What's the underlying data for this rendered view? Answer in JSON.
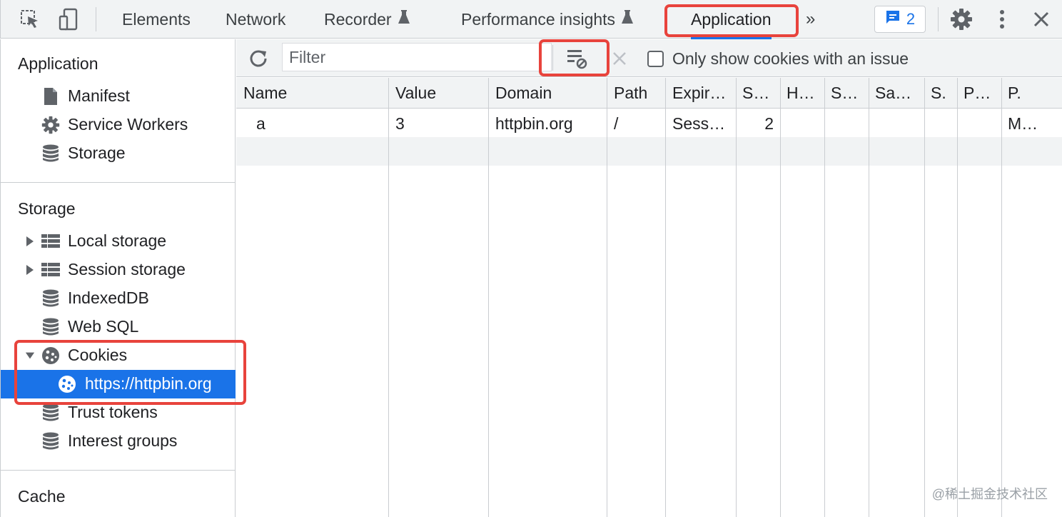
{
  "tabs": {
    "elements": "Elements",
    "network": "Network",
    "recorder": "Recorder",
    "performance_insights": "Performance insights",
    "application": "Application",
    "more": "»",
    "issues_count": "2"
  },
  "sidebar": {
    "application_heading": "Application",
    "application_items": [
      {
        "label": "Manifest",
        "icon": "document-icon"
      },
      {
        "label": "Service Workers",
        "icon": "gear-icon"
      },
      {
        "label": "Storage",
        "icon": "database-icon"
      }
    ],
    "storage_heading": "Storage",
    "storage_items": [
      {
        "label": "Local storage",
        "icon": "table-grid-icon"
      },
      {
        "label": "Session storage",
        "icon": "table-grid-icon"
      },
      {
        "label": "IndexedDB",
        "icon": "database-icon"
      },
      {
        "label": "Web SQL",
        "icon": "database-icon"
      },
      {
        "label": "Cookies",
        "icon": "cookie-icon"
      },
      {
        "label": "https://httpbin.org",
        "icon": "cookie-icon"
      },
      {
        "label": "Trust tokens",
        "icon": "database-icon"
      },
      {
        "label": "Interest groups",
        "icon": "database-icon"
      }
    ],
    "cache_heading": "Cache"
  },
  "toolbar": {
    "filter_placeholder": "Filter",
    "only_issues_label": "Only show cookies with an issue"
  },
  "table": {
    "columns": [
      "Name",
      "Value",
      "Domain",
      "Path",
      "Expir…",
      "S…",
      "H…",
      "S…",
      "Sa…",
      "S.",
      "P…",
      "P."
    ],
    "rows": [
      [
        "a",
        "3",
        "httpbin.org",
        "/",
        "Sess…",
        "2",
        "",
        "",
        "",
        "",
        "",
        "M…"
      ]
    ]
  },
  "watermark": "@稀土掘金技术社区",
  "colors": {
    "accent": "#1a73e8",
    "highlight": "#e8433c",
    "toolbar_bg": "#f1f3f4"
  }
}
